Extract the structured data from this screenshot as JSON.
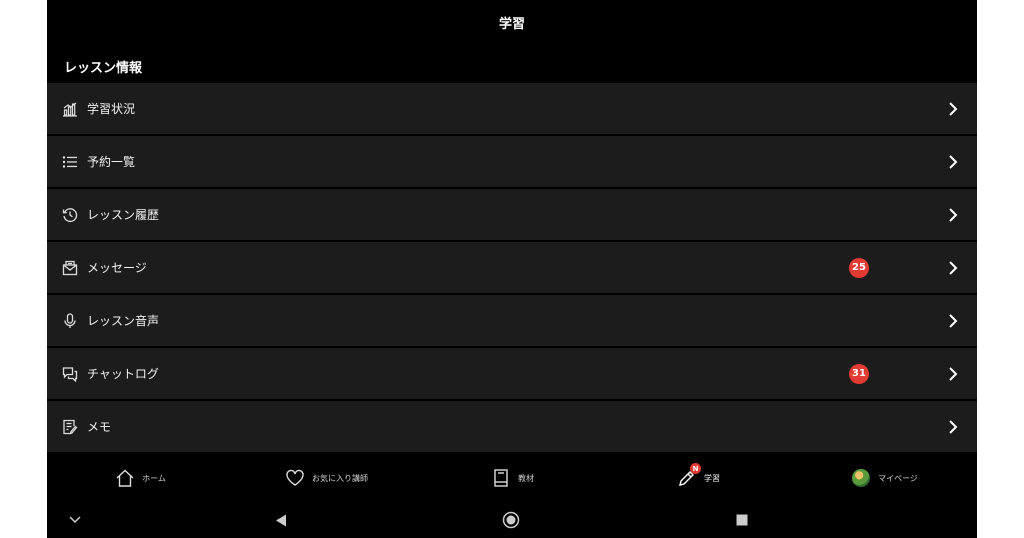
{
  "header": {
    "title": "学習"
  },
  "section": {
    "title": "レッスン情報"
  },
  "menu": [
    {
      "label": "学習状況",
      "icon": "chart-bars-icon",
      "badge": null
    },
    {
      "label": "予約一覧",
      "icon": "list-icon",
      "badge": null
    },
    {
      "label": "レッスン履歴",
      "icon": "history-clock-icon",
      "badge": null
    },
    {
      "label": "メッセージ",
      "icon": "envelope-icon",
      "badge": "25"
    },
    {
      "label": "レッスン音声",
      "icon": "microphone-icon",
      "badge": null
    },
    {
      "label": "チャットログ",
      "icon": "chat-bubbles-icon",
      "badge": "31"
    },
    {
      "label": "メモ",
      "icon": "memo-pencil-icon",
      "badge": null
    }
  ],
  "tabs": [
    {
      "label": "ホーム",
      "icon": "home-icon"
    },
    {
      "label": "お気に入り講師",
      "icon": "heart-icon"
    },
    {
      "label": "教材",
      "icon": "book-icon"
    },
    {
      "label": "学習",
      "icon": "pencil-icon",
      "badge": "N",
      "active": true
    },
    {
      "label": "マイページ",
      "icon": "avatar"
    }
  ],
  "system_nav": [
    "chevron-down-icon",
    "back-triangle-icon",
    "home-circle-icon",
    "recents-square-icon"
  ],
  "colors": {
    "background": "#000000",
    "row": "#1c1c1c",
    "badge": "#e23b34",
    "text": "#ffffff"
  }
}
